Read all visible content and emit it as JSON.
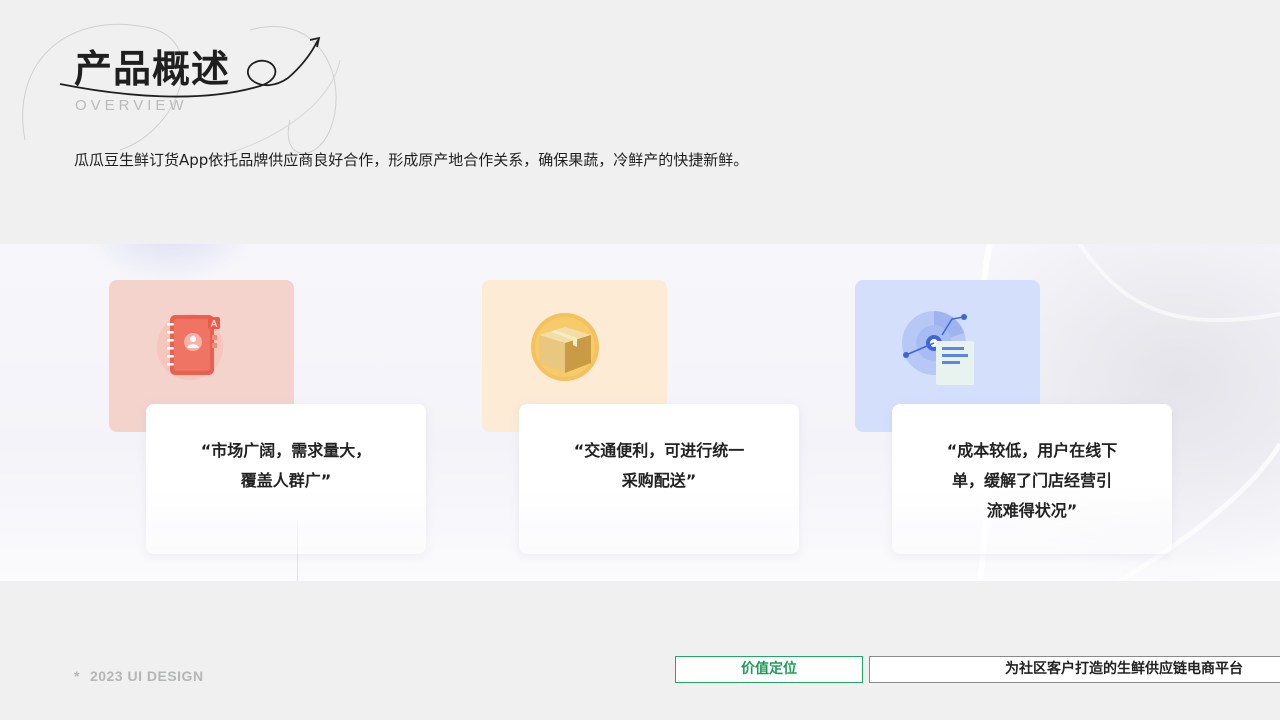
{
  "header": {
    "title": "产品概述",
    "subtitle": "OVERVIEW"
  },
  "intro": "瓜瓜豆生鲜订货App依托品牌供应商良好合作，形成原产地合作关系，确保果蔬，冷鲜产的快捷新鲜。",
  "features": [
    {
      "icon": "address-book-icon",
      "tile_color": "#f4d3cc",
      "line1": "“市场广阔，需求量大，",
      "line2": "覆盖人群广”",
      "line3": ""
    },
    {
      "icon": "package-box-icon",
      "tile_color": "#fdebd6",
      "line1": "“交通便利，可进行统一",
      "line2": "采购配送”",
      "line3": ""
    },
    {
      "icon": "analytics-report-icon",
      "tile_color": "#d4dffc",
      "line1": "“成本较低，用户在线下",
      "line2": "单，缓解了门店经营引",
      "line3": "流难得状况”"
    }
  ],
  "footer": {
    "mark": "2023 UI DESIGN",
    "value_label": "价值定位",
    "value_text": "为社区客户打造的生鲜供应链电商平台"
  },
  "colors": {
    "accent_green": "#20a864",
    "background": "#eff0ef"
  }
}
